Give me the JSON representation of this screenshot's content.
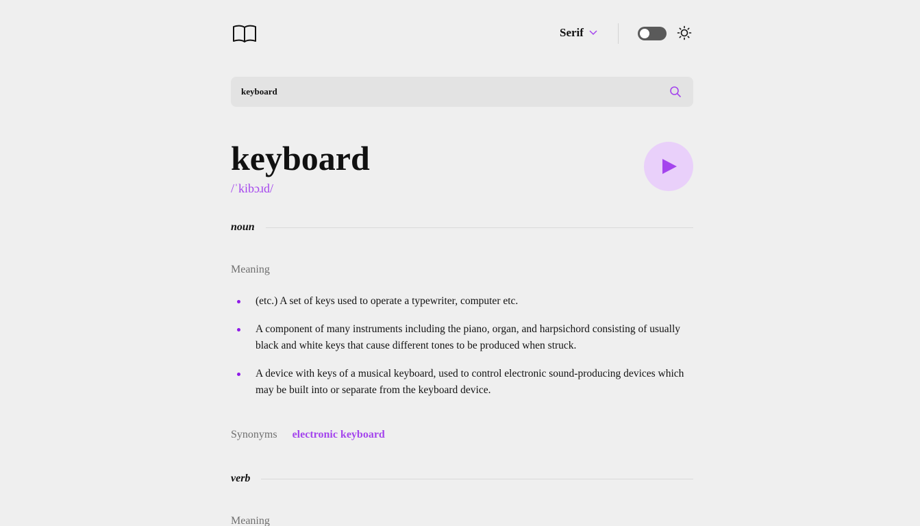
{
  "header": {
    "font_label": "Serif",
    "theme_toggle_state": "off",
    "icons": [
      "book-icon",
      "chevron-down-icon",
      "sun-icon"
    ]
  },
  "search": {
    "value": "keyboard",
    "placeholder": "Search for any word…"
  },
  "entry": {
    "word": "keyboard",
    "phonetic": "/ˈkibɔɹd/",
    "meanings": [
      {
        "part_of_speech": "noun",
        "meaning_label": "Meaning",
        "definitions": [
          "(etc.) A set of keys used to operate a typewriter, computer etc.",
          "A component of many instruments including the piano, organ, and harpsichord consisting of usually black and white keys that cause different tones to be produced when struck.",
          "A device with keys of a musical keyboard, used to control electronic sound-producing devices which may be built into or separate from the keyboard device."
        ],
        "synonyms_label": "Synonyms",
        "synonyms": [
          "electronic keyboard"
        ]
      },
      {
        "part_of_speech": "verb",
        "meaning_label": "Meaning"
      }
    ]
  },
  "colors": {
    "accent": "#a445ed",
    "background": "#efefef",
    "search_bg": "#e3e3e3",
    "play_bg": "#e9d0fa"
  }
}
